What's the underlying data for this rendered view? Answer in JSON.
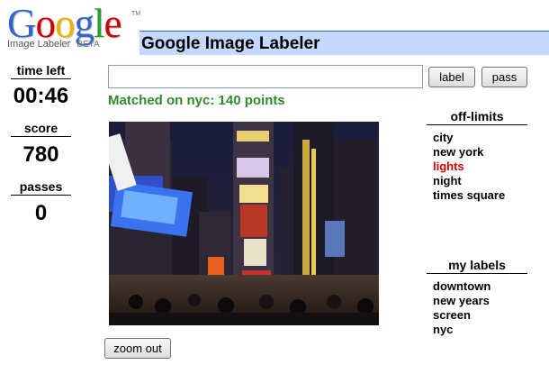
{
  "logo": {
    "letters": [
      {
        "char": "G",
        "color": "#3366cc"
      },
      {
        "char": "o",
        "color": "#cc0000"
      },
      {
        "char": "o",
        "color": "#f0b000"
      },
      {
        "char": "g",
        "color": "#3366cc"
      },
      {
        "char": "l",
        "color": "#2e9e2e"
      },
      {
        "char": "e",
        "color": "#cc0000"
      }
    ],
    "trademark": "TM",
    "product": "Image Labeler",
    "beta": "BETA"
  },
  "header": {
    "title": "Google Image Labeler"
  },
  "stats": {
    "time_left_label": "time left",
    "time_left_value": "00:46",
    "score_label": "score",
    "score_value": "780",
    "passes_label": "passes",
    "passes_value": "0"
  },
  "guess": {
    "value": ""
  },
  "actions": {
    "label_button": "label",
    "pass_button": "pass",
    "zoom_out_button": "zoom out"
  },
  "status": {
    "match_message": "Matched on nyc: 140 points",
    "match_color": "#2e8b2e"
  },
  "off_limits": {
    "heading": "off-limits",
    "items": [
      "city",
      "new york",
      "lights",
      "night",
      "times square"
    ],
    "highlight_color": "#dd0000"
  },
  "my_labels": {
    "heading": "my labels",
    "items": [
      "downtown",
      "new years",
      "screen",
      "nyc"
    ]
  },
  "photo": {
    "subject": "times-square-night-photo"
  }
}
